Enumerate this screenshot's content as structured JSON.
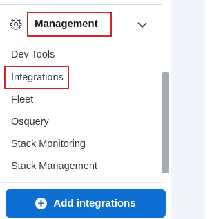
{
  "group": {
    "title": "Management",
    "icon": "gear-icon",
    "toggle_icon": "chevron-down-icon"
  },
  "nav_items": [
    {
      "label": "Dev Tools"
    },
    {
      "label": "Integrations"
    },
    {
      "label": "Fleet"
    },
    {
      "label": "Osquery"
    },
    {
      "label": "Stack Monitoring"
    },
    {
      "label": "Stack Management"
    }
  ],
  "footer": {
    "add_button_label": "Add integrations",
    "add_button_icon": "plus-circle-icon"
  },
  "colors": {
    "accent": "#0d6ed4",
    "highlight_box": "#d6232b",
    "text": "#343741"
  }
}
